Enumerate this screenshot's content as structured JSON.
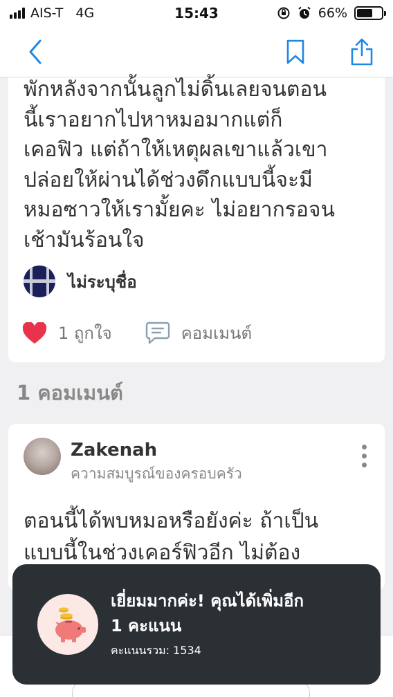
{
  "status_bar": {
    "carrier": "AIS-T",
    "network": "4G",
    "time": "15:43",
    "battery": "66%",
    "battery_level": 0.66
  },
  "nav": {
    "back_icon": "chevron-left-icon",
    "bookmark_icon": "bookmark-icon",
    "share_icon": "share-icon",
    "accent_color": "#1e88e5"
  },
  "post": {
    "body_lines": [
      "พักหลังจากนั้นลูกไม่ดิ้นเลยจนตอน",
      "นี้เราอยากไปหาหมอมากแต่ก็",
      "เคอฟิว แต่ถ้าให้เหตุผลเขาแล้วเขา",
      "ปล่อยให้ผ่านได้ช่วงดึกแบบนี้จะมี",
      "หมอซาวให้เรามั้ยคะ ไม่อยากรอจน",
      "เช้ามันร้อนใจ"
    ],
    "author": "ไม่ระบุชื่อ",
    "likes_label": "1 ถูกใจ",
    "comment_label": "คอมเมนต์",
    "heart_color": "#e8334a"
  },
  "comments_section": {
    "header": "1 คอมเมนต์",
    "comments": [
      {
        "name": "Zakenah",
        "subtitle": "ความสมบูรณ์ของครอบครัว",
        "body_lines": [
          "ตอนนี้ได้พบหมอหรือยังค่ะ ถ้าเป็น",
          "แบบนี้ในช่วงเคอร์ฟิวอีก  ไม่ต้อง"
        ]
      }
    ]
  },
  "toast": {
    "icon": "piggy-bank-icon",
    "title": "เยี่ยมมากค่ะ! คุณได้เพิ่มอีก",
    "points": "1 คะแนน",
    "total": "คะแนนรวม: 1534"
  }
}
